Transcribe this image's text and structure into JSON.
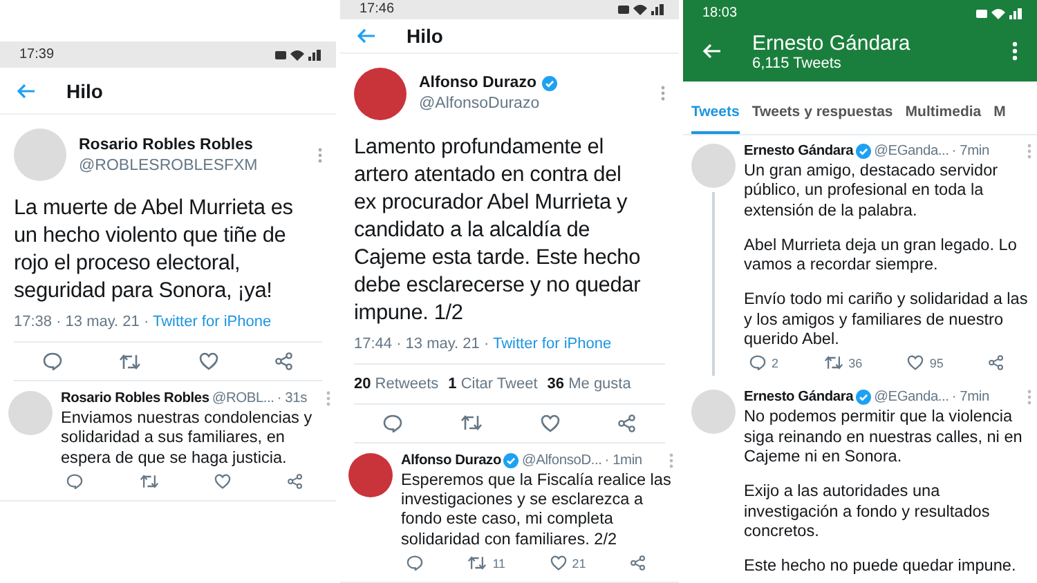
{
  "panels": [
    {
      "status_bar": {
        "time": "17:39"
      },
      "header": {
        "kind": "thread",
        "title": "Hilo"
      },
      "focus_tweet": {
        "name": "Rosario Robles Robles",
        "handle": "@ROBLESROBLESFXM",
        "text": "La muerte de Abel Murrieta es un hecho violento que tiñe de rojo el proceso electoral, seguridad para Sonora, ¡ya!",
        "meta": "17:38 · 13 may. 21 · ",
        "source": "Twitter for iPhone",
        "actions": [
          {
            "kind": "reply"
          },
          {
            "kind": "retweet"
          },
          {
            "kind": "like"
          },
          {
            "kind": "share"
          }
        ]
      },
      "tweets": [
        {
          "name": "Rosario Robles Robles",
          "handle": "@ROBL...",
          "time": "· 31s",
          "paragraphs": [
            "Enviamos nuestras condolencias y solidaridad a sus familiares, en espera de que se haga justicia."
          ],
          "actions": [
            {
              "kind": "reply"
            },
            {
              "kind": "retweet"
            },
            {
              "kind": "like"
            },
            {
              "kind": "share"
            }
          ]
        }
      ]
    },
    {
      "status_bar": {
        "time": "17:46"
      },
      "header": {
        "kind": "thread",
        "title": "Hilo"
      },
      "focus_tweet": {
        "name": "Alfonso Durazo",
        "verified": true,
        "handle": "@AlfonsoDurazo",
        "text": "Lamento profundamente el artero atentado en contra del ex procurador Abel Murrieta y candidato a la alcaldía de Cajeme esta tarde. Este hecho debe esclarecerse y no quedar impune. 1/2",
        "meta": "17:44 · 13 may. 21 · ",
        "source": "Twitter for iPhone",
        "stats": [
          {
            "count": "20",
            "label": "Retweets"
          },
          {
            "count": "1",
            "label": "Citar Tweet"
          },
          {
            "count": "36",
            "label": "Me gusta"
          }
        ],
        "actions": [
          {
            "kind": "reply"
          },
          {
            "kind": "retweet"
          },
          {
            "kind": "like"
          },
          {
            "kind": "share"
          }
        ]
      },
      "tweets": [
        {
          "name": "Alfonso Durazo",
          "verified": true,
          "handle": "@AlfonsoD...",
          "time": "· 1min",
          "paragraphs": [
            "Esperemos que la Fiscalía realice las investigaciones y se esclarezca a fondo este caso, mi completa solidaridad con familiares. 2/2"
          ],
          "actions": [
            {
              "kind": "reply"
            },
            {
              "kind": "retweet",
              "count": "11"
            },
            {
              "kind": "like",
              "count": "21"
            },
            {
              "kind": "share"
            }
          ]
        }
      ]
    },
    {
      "status_bar": {
        "time": "18:03"
      },
      "header": {
        "kind": "profile",
        "title": "Ernesto Gándara",
        "subtitle": "6,115 Tweets"
      },
      "tabs": [
        {
          "label": "Tweets",
          "selected": true
        },
        {
          "label": "Tweets y respuestas",
          "selected": false
        },
        {
          "label": "Multimedia",
          "selected": false
        },
        {
          "label": "M",
          "selected": false
        }
      ],
      "tweets": [
        {
          "name": "Ernesto Gándara",
          "verified": true,
          "handle": "@EGanda...",
          "time": "· 7min",
          "thread_line": true,
          "paragraphs": [
            "Un gran amigo, destacado servidor público, un profesional en toda la extensión de la palabra.",
            "Abel Murrieta deja un gran legado. Lo vamos a recordar siempre.",
            "Envío todo mi cariño y solidaridad a las y los amigos y familiares de nuestro querido Abel."
          ],
          "actions": [
            {
              "kind": "reply",
              "count": "2"
            },
            {
              "kind": "retweet",
              "count": "36"
            },
            {
              "kind": "like",
              "count": "95"
            },
            {
              "kind": "share"
            }
          ]
        },
        {
          "name": "Ernesto Gándara",
          "verified": true,
          "handle": "@EGanda...",
          "time": "· 7min",
          "paragraphs": [
            "No podemos permitir que la violencia siga reinando en nuestras calles, ni en Cajeme ni en Sonora.",
            "Exijo a las autoridades una investigación a fondo y resultados concretos.",
            "Este hecho no puede quedar impune."
          ]
        }
      ]
    }
  ]
}
